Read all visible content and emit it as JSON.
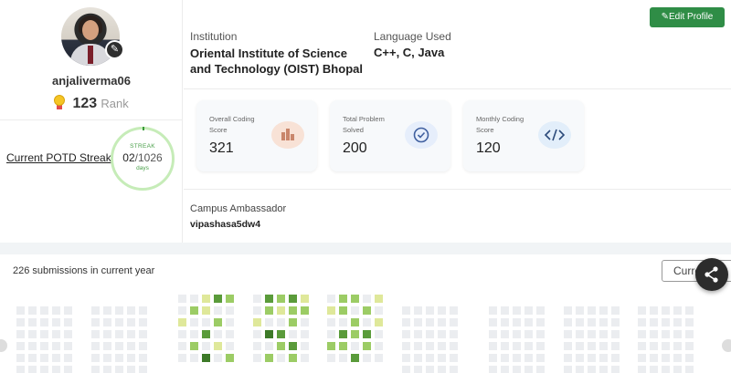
{
  "profile": {
    "username": "anjaliverma06",
    "rank_value": "123",
    "rank_label": "Rank",
    "potd_label": "Current POTD Streak",
    "streak": {
      "label": "STREAK",
      "current": "02",
      "total": "/1026",
      "unit": "days"
    }
  },
  "details": {
    "edit_profile_label": "Edit Profile",
    "institution_label": "Institution",
    "institution_value": "Oriental Institute of Science and Technology (OIST) Bhopal",
    "language_label": "Language Used",
    "language_value": "C++, C, Java"
  },
  "stats": [
    {
      "label": "Overall Coding Score",
      "value": "321",
      "icon": "bar-chart-icon"
    },
    {
      "label": "Total Problem Solved",
      "value": "200",
      "icon": "check-circle-icon"
    },
    {
      "label": "Monthly Coding Score",
      "value": "120",
      "icon": "code-icon"
    }
  ],
  "ambassador": {
    "label": "Campus Ambassador",
    "value": "vipashasa5dw4"
  },
  "submissions": {
    "count_text": "226 submissions in current year",
    "year_select_value": "Curre",
    "colors": {
      "empty": "#ebedf0",
      "light": "#dfe89a",
      "mid": "#9ccc65",
      "dark": "#5a9b3a",
      "darker": "#3d7a28"
    }
  }
}
